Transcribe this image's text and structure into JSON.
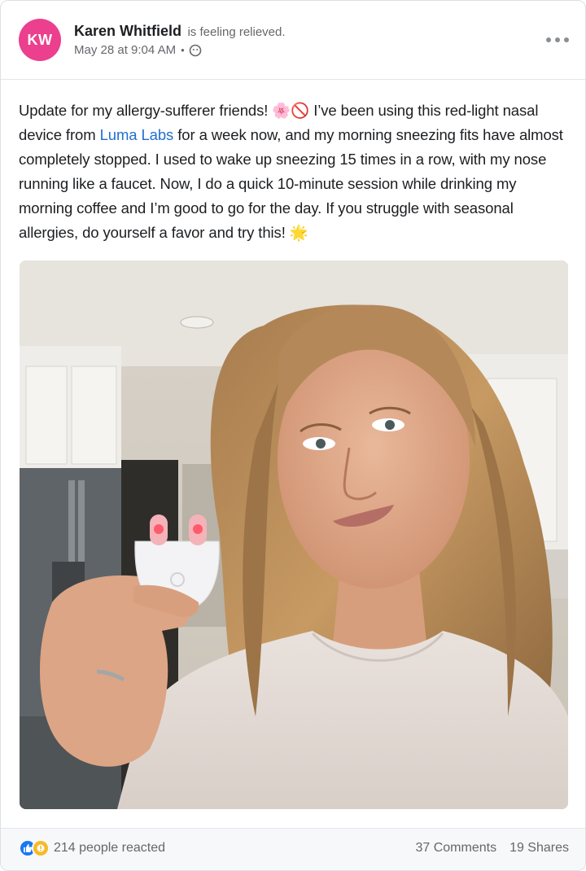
{
  "post": {
    "author": {
      "initials": "KW",
      "name": "Karen Whitfield",
      "feeling": "is feeling relieved.",
      "avatar_color": "#ec3f8e"
    },
    "timestamp": "May 28 at 9:04 AM",
    "meta_separator": "•",
    "audience_icon": "friends-circle-icon",
    "text": {
      "part1": "Update for my allergy-sufferer friends! 🌸🚫 I’ve been using this red-light nasal device from ",
      "link": "Luma Labs",
      "part2": " for a week now, and my morning sneezing fits have almost completely stopped. I used to wake up sneezing 15 times in a row, with my nose running like a faucet. Now, I do a quick 10-minute session while drinking my morning coffee and I’m good to go for the day. If you struggle with seasonal allergies, do yourself a favor and try this! 🌟"
    },
    "photo_description": "selfie-holding-red-light-nasal-device"
  },
  "footer": {
    "reaction_icons": [
      "like-icon",
      "care-icon"
    ],
    "reactions_label": "214 people reacted",
    "comments_label": "37 Comments",
    "shares_label": "19 Shares"
  },
  "colors": {
    "link": "#1f6fd1",
    "like": "#1877f2",
    "care": "#f7b928",
    "muted_text": "#65676b"
  }
}
